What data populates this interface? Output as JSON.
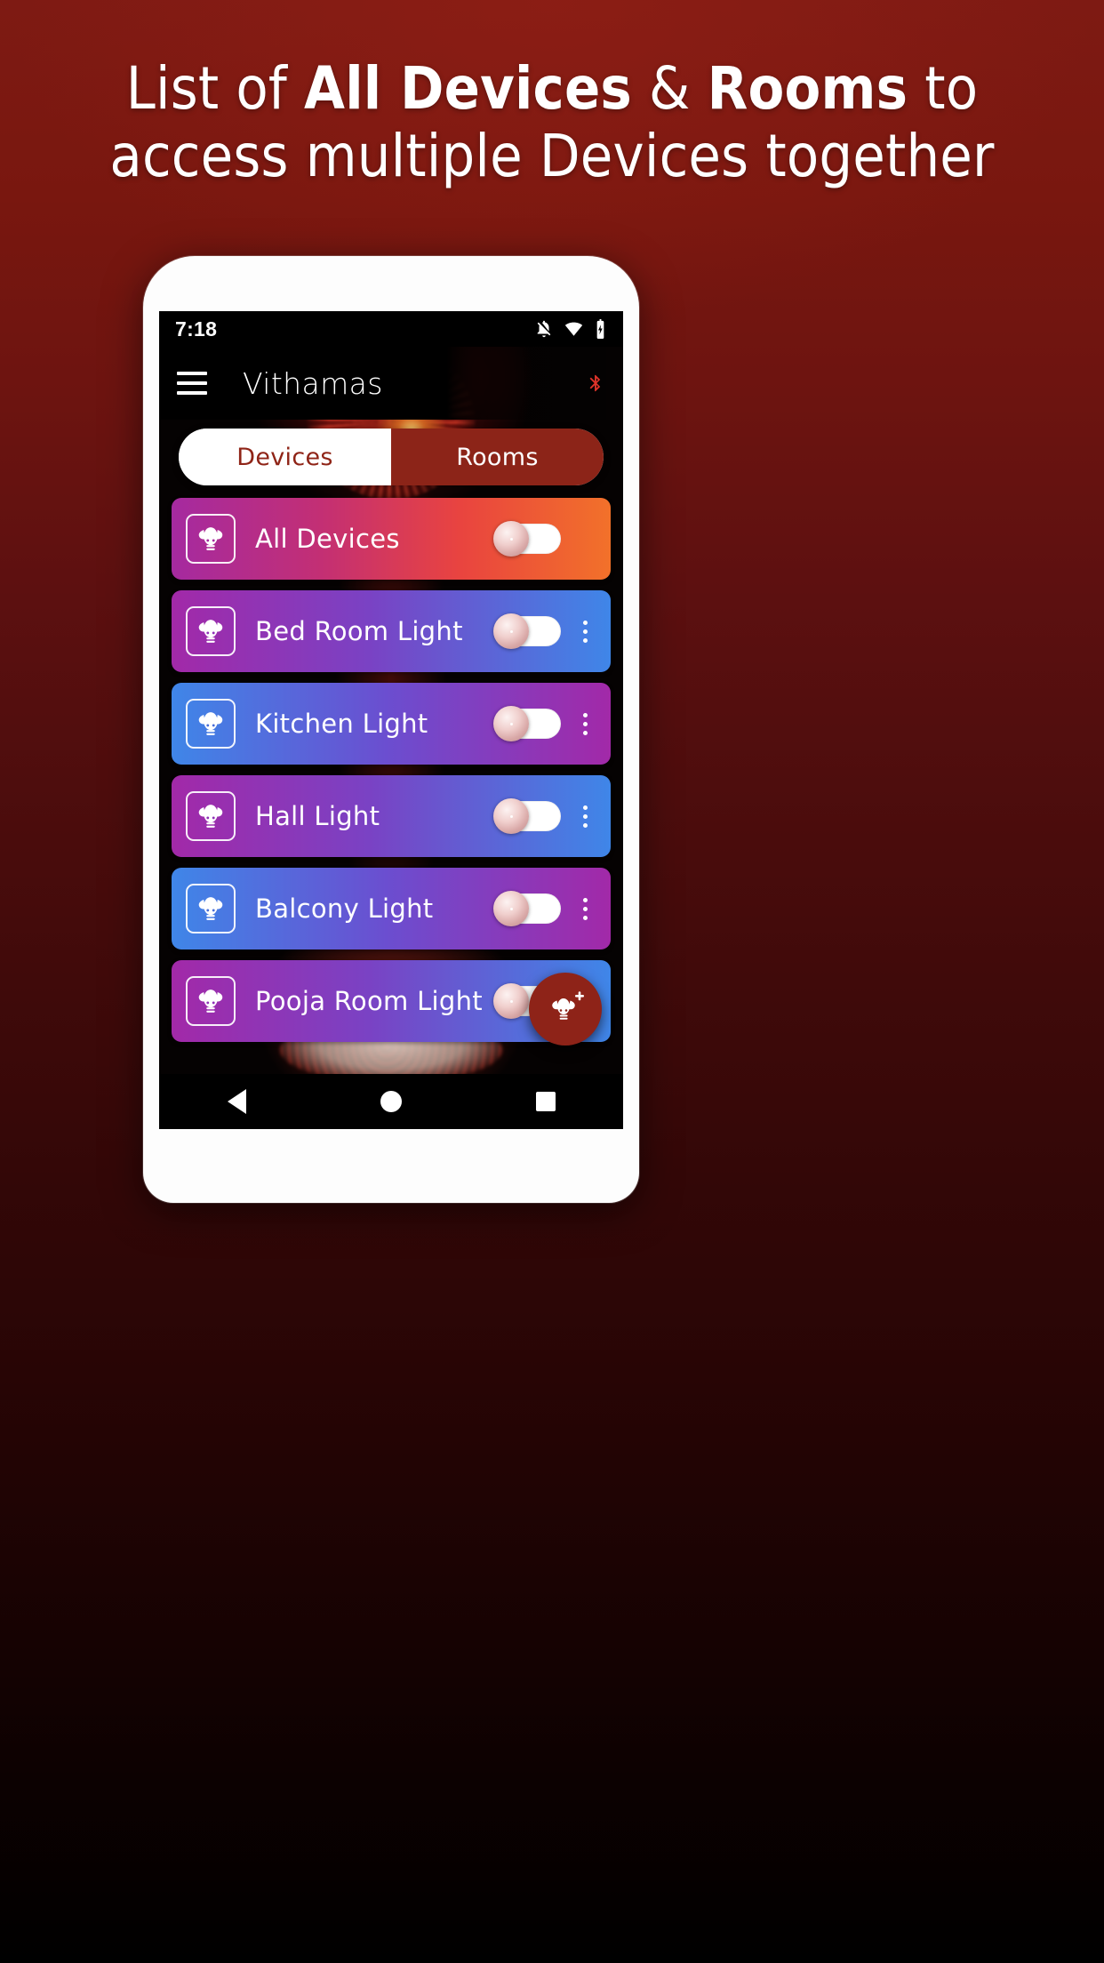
{
  "promo": {
    "headline_line1_prefix": "List of ",
    "headline_line1_bold1": "All Devices",
    "headline_line1_mid": " & ",
    "headline_line1_bold2": "Rooms",
    "headline_line1_suffix": " to",
    "headline_line2": "access multiple Devices together",
    "background_top_color": "#7e1a13",
    "background_bottom_color": "#000000",
    "text_color": "#ffffff"
  },
  "phone": {
    "frame_color": "#fdfdfd"
  },
  "statusbar": {
    "clock": "7:18",
    "icons": [
      "notifications-off-icon",
      "wifi-icon",
      "battery-charging-icon"
    ]
  },
  "appbar": {
    "menu_icon": "hamburger-menu-icon",
    "title": "Vithamas",
    "bluetooth_icon": "bluetooth-icon",
    "bluetooth_color": "#e0342a"
  },
  "tabs": {
    "items": [
      {
        "label": "Devices",
        "active": false
      },
      {
        "label": "Rooms",
        "active": true
      }
    ],
    "active_bg": "#8c2418",
    "inactive_bg": "#ffffff",
    "inactive_text": "#8f2417"
  },
  "devices": [
    {
      "label": "All Devices",
      "icon": "light-bulb-icon",
      "toggle_state": "off",
      "has_menu": false,
      "gradient": "allDevices",
      "gradient_from": "#a52aa0",
      "gradient_to": "#f2712a"
    },
    {
      "label": "Bed Room Light",
      "icon": "light-bulb-icon",
      "toggle_state": "off",
      "has_menu": true,
      "gradient": "purpleBlue",
      "gradient_from": "#a229a8",
      "gradient_to": "#3f86e8"
    },
    {
      "label": "Kitchen Light",
      "icon": "light-bulb-icon",
      "toggle_state": "off",
      "has_menu": true,
      "gradient": "bluePurple",
      "gradient_from": "#3f86e8",
      "gradient_to": "#a229a8"
    },
    {
      "label": "Hall Light",
      "icon": "light-bulb-icon",
      "toggle_state": "off",
      "has_menu": true,
      "gradient": "purpleBlue",
      "gradient_from": "#a229a8",
      "gradient_to": "#3f86e8"
    },
    {
      "label": "Balcony Light",
      "icon": "light-bulb-icon",
      "toggle_state": "off",
      "has_menu": true,
      "gradient": "bluePurple",
      "gradient_from": "#3f86e8",
      "gradient_to": "#a229a8"
    },
    {
      "label": "Pooja Room Light",
      "icon": "light-bulb-icon",
      "toggle_state": "off",
      "has_menu": true,
      "gradient": "purpleBlue",
      "gradient_from": "#a229a8",
      "gradient_to": "#3f86e8"
    }
  ],
  "fab": {
    "icon": "add-bulb-icon",
    "color": "#8e2318"
  },
  "navbar": {
    "back_icon": "back-triangle-icon",
    "home_icon": "home-circle-icon",
    "recents_icon": "recents-square-icon"
  }
}
